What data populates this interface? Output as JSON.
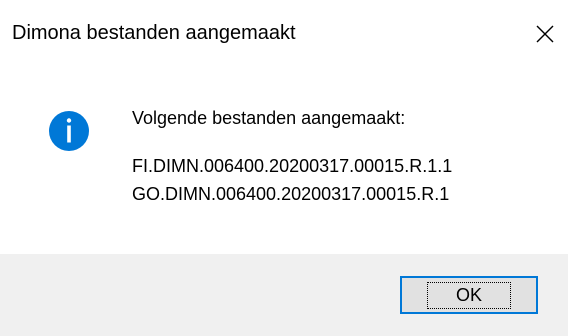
{
  "dialog": {
    "title": "Dimona bestanden aangemaakt",
    "message": "Volgende bestanden aangemaakt:",
    "files": [
      "FI.DIMN.006400.20200317.00015.R.1.1",
      "GO.DIMN.006400.20200317.00015.R.1"
    ],
    "ok_label": "OK",
    "icons": {
      "close": "close-icon",
      "info": "info-icon"
    },
    "colors": {
      "accent": "#0078d7",
      "footer_bg": "#f0f0f0",
      "info_blue": "#0078d7"
    }
  }
}
